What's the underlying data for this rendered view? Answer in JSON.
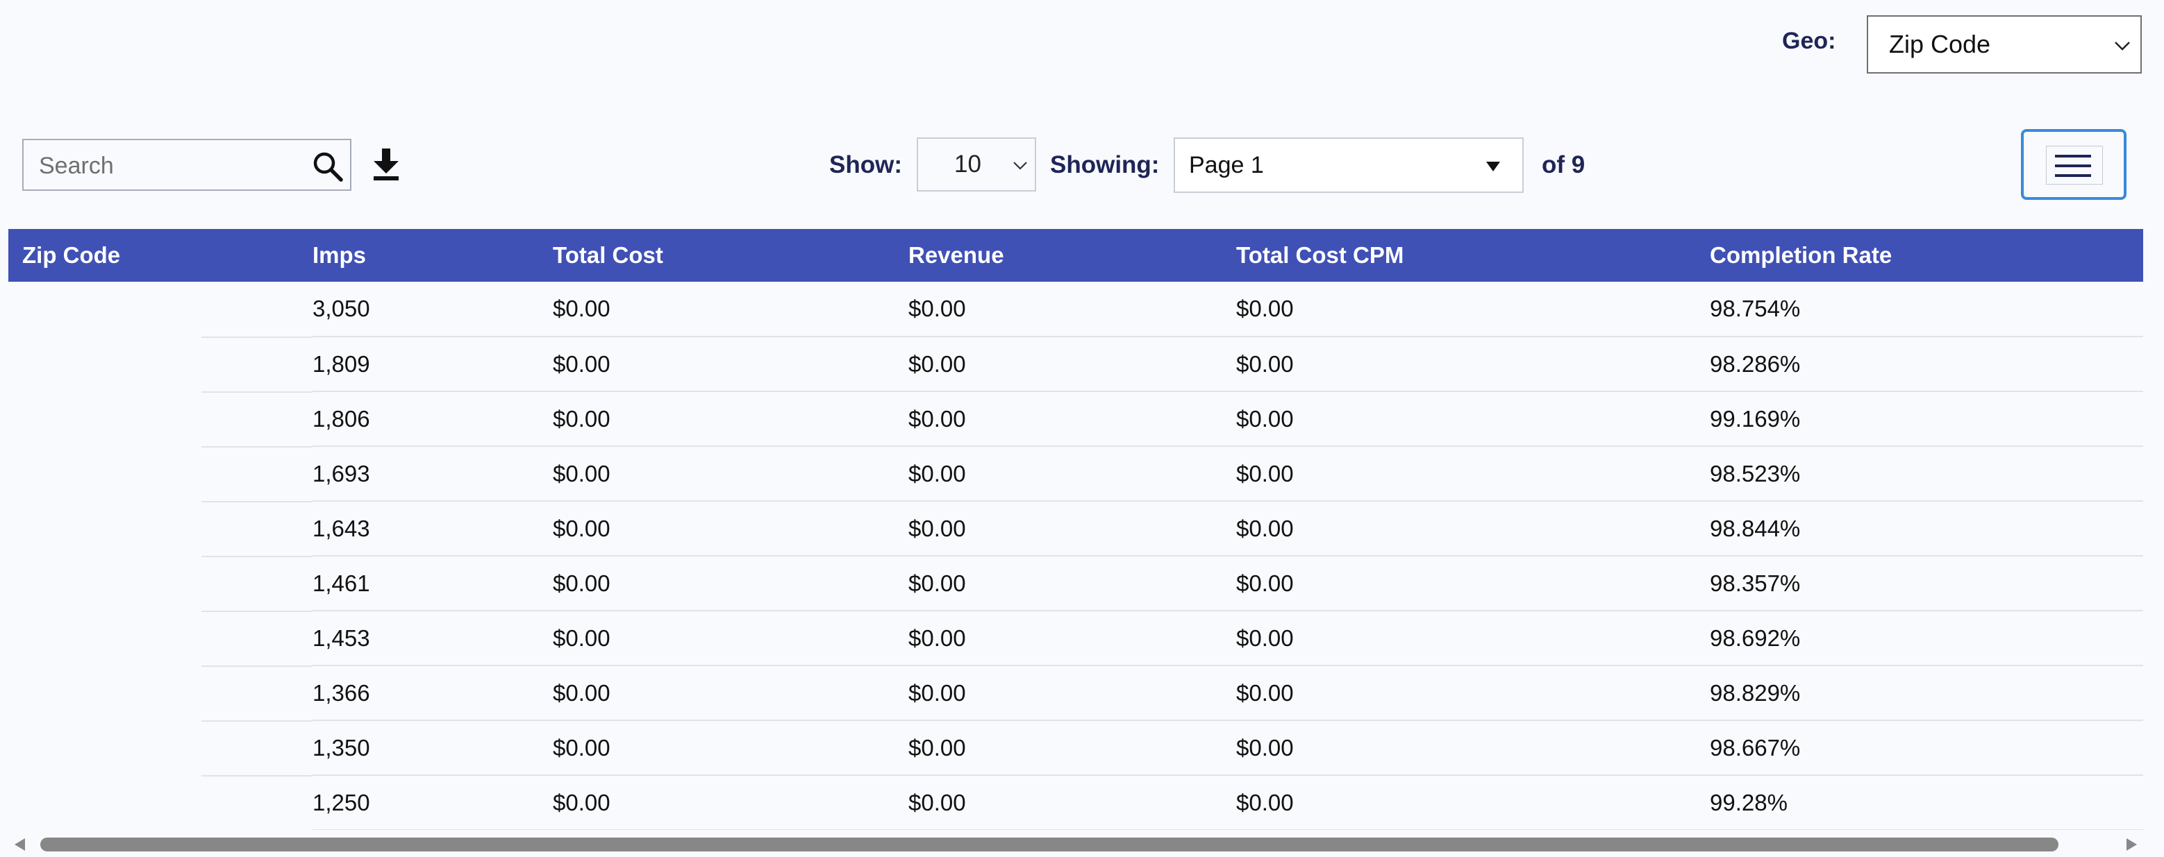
{
  "geo": {
    "label": "Geo:",
    "selected": "Zip Code"
  },
  "search": {
    "placeholder": "Search"
  },
  "icons": {
    "search": "search-icon",
    "download": "download-icon",
    "menu": "hamburger-menu-icon",
    "chevron": "chevron-down-icon",
    "dropdown": "triangle-down-icon",
    "scroll_left": "triangle-left-icon",
    "scroll_right": "triangle-right-icon"
  },
  "pagination": {
    "show_label": "Show:",
    "show_value": "10",
    "showing_label": "Showing:",
    "page_value": "Page 1",
    "of_label": "of 9"
  },
  "colors": {
    "header_bg": "#4051b5",
    "label_color": "#1f2556",
    "menu_border": "#3a8ad8"
  },
  "table": {
    "columns": [
      "Zip Code",
      "Imps",
      "Total Cost",
      "Revenue",
      "Total Cost CPM",
      "Completion Rate"
    ],
    "rows": [
      {
        "zip": "",
        "imps": "3,050",
        "total_cost": "$0.00",
        "revenue": "$0.00",
        "cpm": "$0.00",
        "completion": "98.754%"
      },
      {
        "zip": "",
        "imps": "1,809",
        "total_cost": "$0.00",
        "revenue": "$0.00",
        "cpm": "$0.00",
        "completion": "98.286%"
      },
      {
        "zip": "",
        "imps": "1,806",
        "total_cost": "$0.00",
        "revenue": "$0.00",
        "cpm": "$0.00",
        "completion": "99.169%"
      },
      {
        "zip": "",
        "imps": "1,693",
        "total_cost": "$0.00",
        "revenue": "$0.00",
        "cpm": "$0.00",
        "completion": "98.523%"
      },
      {
        "zip": "",
        "imps": "1,643",
        "total_cost": "$0.00",
        "revenue": "$0.00",
        "cpm": "$0.00",
        "completion": "98.844%"
      },
      {
        "zip": "",
        "imps": "1,461",
        "total_cost": "$0.00",
        "revenue": "$0.00",
        "cpm": "$0.00",
        "completion": "98.357%"
      },
      {
        "zip": "",
        "imps": "1,453",
        "total_cost": "$0.00",
        "revenue": "$0.00",
        "cpm": "$0.00",
        "completion": "98.692%"
      },
      {
        "zip": "",
        "imps": "1,366",
        "total_cost": "$0.00",
        "revenue": "$0.00",
        "cpm": "$0.00",
        "completion": "98.829%"
      },
      {
        "zip": "",
        "imps": "1,350",
        "total_cost": "$0.00",
        "revenue": "$0.00",
        "cpm": "$0.00",
        "completion": "98.667%"
      },
      {
        "zip": "",
        "imps": "1,250",
        "total_cost": "$0.00",
        "revenue": "$0.00",
        "cpm": "$0.00",
        "completion": "99.28%"
      }
    ]
  }
}
